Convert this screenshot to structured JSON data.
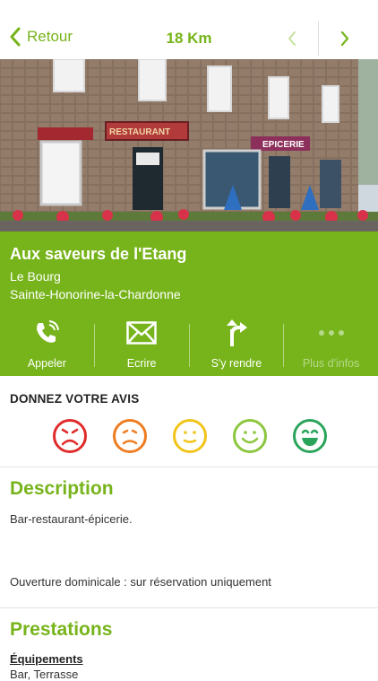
{
  "header": {
    "back_label": "Retour",
    "distance": "18 Km"
  },
  "place": {
    "name": "Aux saveurs de l'Etang",
    "address_line1": "Le Bourg",
    "address_line2": "Sainte-Honorine-la-Chardonne",
    "photo_signs": [
      "RESTAURANT",
      "EPICERIE"
    ]
  },
  "actions": [
    {
      "label": "Appeler",
      "icon": "phone-icon"
    },
    {
      "label": "Ecrire",
      "icon": "envelope-icon"
    },
    {
      "label": "S'y rendre",
      "icon": "directions-icon"
    },
    {
      "label": "Plus d'infos",
      "icon": "more-dots-icon"
    }
  ],
  "rating": {
    "title": "DONNEZ VOTRE AVIS",
    "smileys": [
      {
        "name": "very-sad",
        "color": "#e02b2b"
      },
      {
        "name": "sad",
        "color": "#ee7d22"
      },
      {
        "name": "neutral",
        "color": "#f1c419"
      },
      {
        "name": "happy",
        "color": "#8cc63f"
      },
      {
        "name": "very-happy",
        "color": "#2aa45a"
      }
    ]
  },
  "description": {
    "title": "Description",
    "text1": "Bar-restaurant-épicerie.",
    "text2": "Ouverture dominicale : sur réservation uniquement"
  },
  "prestations": {
    "title": "Prestations",
    "equipements_title": "Équipements",
    "equipements_first": "Bar, Terrasse"
  },
  "colors": {
    "accent": "#77b41b"
  }
}
